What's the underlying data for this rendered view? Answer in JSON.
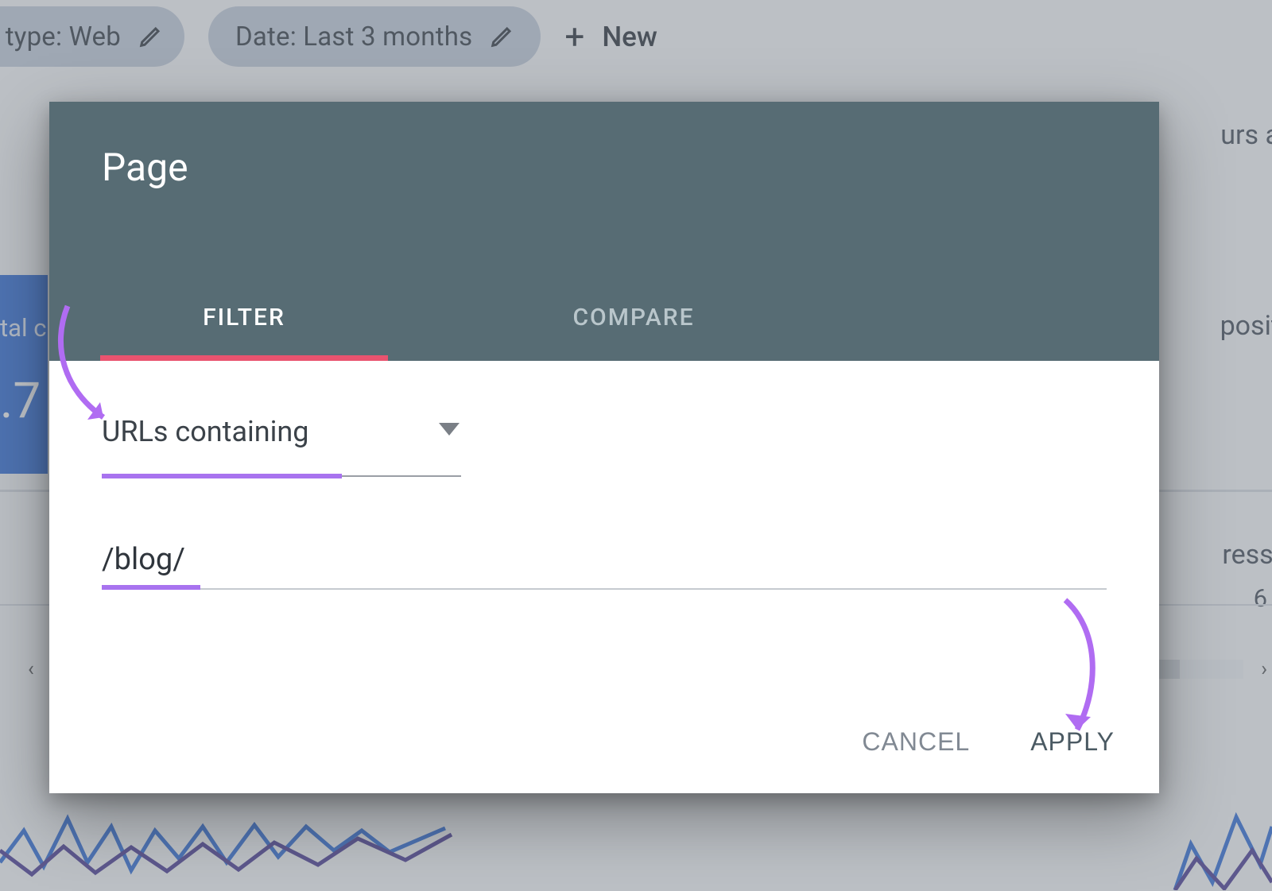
{
  "chips": {
    "search_type": {
      "label": "h type: Web"
    },
    "date": {
      "label": "Date: Last 3 months"
    },
    "new_label": "New"
  },
  "bg": {
    "right_text_1": "urs a",
    "right_text_2": "posit",
    "right_text_3": "ressi",
    "right_text_4": "6",
    "left_label": "tal c",
    "left_value": ".7"
  },
  "modal": {
    "title": "Page",
    "tabs": {
      "filter": "FILTER",
      "compare": "COMPARE",
      "active": "filter"
    },
    "select": {
      "label": "URLs containing"
    },
    "input": {
      "value": "/blog/"
    },
    "actions": {
      "cancel": "CANCEL",
      "apply": "APPLY"
    }
  }
}
